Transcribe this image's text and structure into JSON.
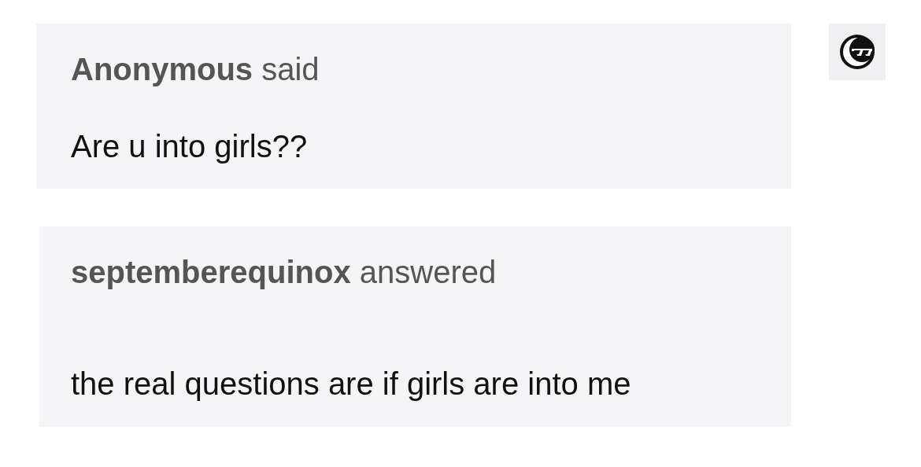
{
  "question": {
    "header": "**Anonymous** said",
    "text": "Are u into girls??"
  },
  "answer": {
    "header": "**septemberequinox** answered",
    "text": "the real questions are if girls are into me"
  }
}
